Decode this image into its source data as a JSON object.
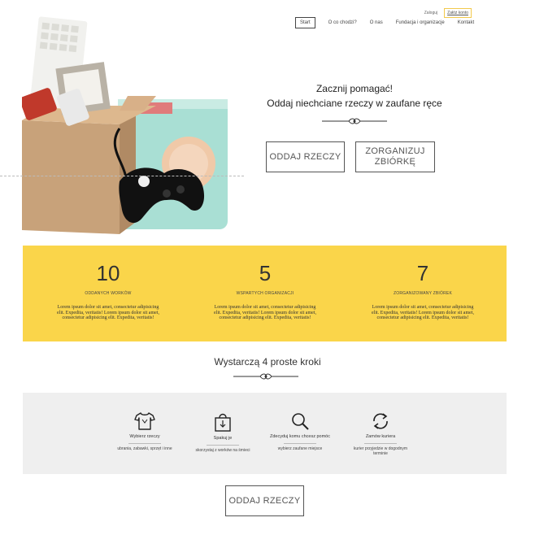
{
  "auth": {
    "login": "Zaloguj",
    "register": "Załóż konto"
  },
  "nav": [
    {
      "label": "Start"
    },
    {
      "label": "O co chodzi?"
    },
    {
      "label": "O nas"
    },
    {
      "label": "Fundacja i organizacje"
    },
    {
      "label": "Kontakt"
    }
  ],
  "hero": {
    "line1": "Zacznij pomagać!",
    "line2": "Oddaj niechciane rzeczy w zaufane ręce",
    "btn_donate": "Oddaj rzeczy",
    "btn_collect": "Zorganizuj zbiórkę"
  },
  "stats": [
    {
      "number": "10",
      "label": "Oddanych worków",
      "desc": "Lorem ipsum dolor sit amet, consectetur adipisicing elit. Expedita, veritatis! Lorem ipsum dolor sit amet, consectetur adipisicing elit. Expedita, veritatis!"
    },
    {
      "number": "5",
      "label": "Wspartych organizacji",
      "desc": "Lorem ipsum dolor sit amet, consectetur adipisicing elit. Expedita, veritatis! Lorem ipsum dolor sit amet, consectetur adipisicing elit. Expedita, veritatis!"
    },
    {
      "number": "7",
      "label": "Zorganizowany zbiórek",
      "desc": "Lorem ipsum dolor sit amet, consectetur adipisicing elit. Expedita, veritatis! Lorem ipsum dolor sit amet, consectetur adipisicing elit. Expedita, veritatis!"
    }
  ],
  "steps_title": "Wystarczą 4 proste kroki",
  "steps": [
    {
      "icon": "tshirt-icon",
      "title": "Wybierz rzeczy",
      "desc": "ubrania, zabawki, sprzęt i inne"
    },
    {
      "icon": "bag-icon",
      "title": "Spakuj je",
      "desc": "skorzystaj z worków na śmieci"
    },
    {
      "icon": "magnifier-icon",
      "title": "Zdecyduj komu chcesz pomóc",
      "desc": "wybierz zaufane miejsce"
    },
    {
      "icon": "refresh-icon",
      "title": "Zamów kuriera",
      "desc": "kurier przyjedzie w dogodnym terminie"
    }
  ],
  "bottom_btn": "Oddaj rzeczy",
  "colors": {
    "accent": "#fad54a",
    "steps_bg": "#efefef"
  }
}
